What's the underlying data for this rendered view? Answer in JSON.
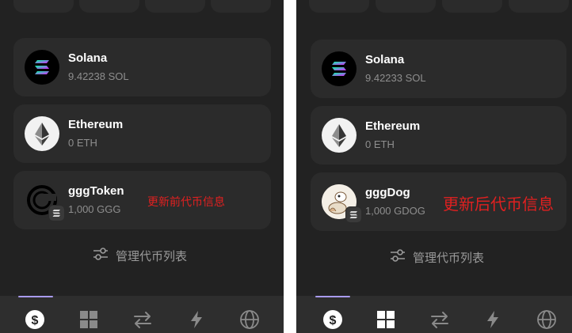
{
  "left": {
    "tokens": [
      {
        "name": "Solana",
        "amount": "9.42238 SOL"
      },
      {
        "name": "Ethereum",
        "amount": "0 ETH"
      },
      {
        "name": "gggToken",
        "amount": "1,000 GGG"
      }
    ],
    "annotation": "更新前代币信息",
    "manage_label": "管理代币列表",
    "active_nav": "dollar"
  },
  "right": {
    "tokens": [
      {
        "name": "Solana",
        "amount": "9.42233 SOL"
      },
      {
        "name": "Ethereum",
        "amount": "0 ETH"
      },
      {
        "name": "gggDog",
        "amount": "1,000 GDOG"
      }
    ],
    "annotation": "更新后代币信息",
    "manage_label": "管理代币列表",
    "active_nav": "dollar"
  },
  "nav_items": [
    "dollar-icon",
    "grid-icon",
    "swap-icon",
    "lightning-icon",
    "globe-icon"
  ],
  "colors": {
    "background": "#222222",
    "card": "#2b2b2b",
    "annotation": "#e02020",
    "nav_indicator": "#a99bf0"
  }
}
